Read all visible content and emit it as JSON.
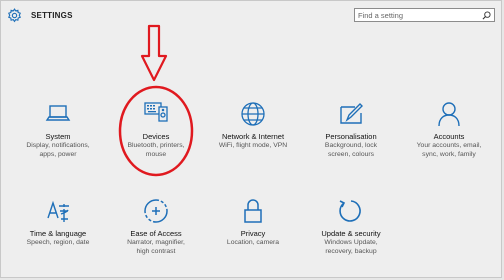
{
  "header": {
    "title": "SETTINGS",
    "search_placeholder": "Find a setting"
  },
  "tiles": [
    {
      "icon": "system-icon",
      "name": "System",
      "desc": [
        "Display, notifications,",
        "apps, power"
      ]
    },
    {
      "icon": "devices-icon",
      "name": "Devices",
      "desc": [
        "Bluetooth, printers,",
        "mouse"
      ]
    },
    {
      "icon": "network-icon",
      "name": "Network & Internet",
      "desc": [
        "WiFi, flight mode, VPN"
      ]
    },
    {
      "icon": "personalisation-icon",
      "name": "Personalisation",
      "desc": [
        "Background, lock",
        "screen, colours"
      ]
    },
    {
      "icon": "accounts-icon",
      "name": "Accounts",
      "desc": [
        "Your accounts, email,",
        "sync, work, family"
      ]
    },
    {
      "icon": "time-language-icon",
      "name": "Time & language",
      "desc": [
        "Speech, region, date"
      ]
    },
    {
      "icon": "ease-of-access-icon",
      "name": "Ease of Access",
      "desc": [
        "Narrator, magnifier,",
        "high contrast"
      ]
    },
    {
      "icon": "privacy-icon",
      "name": "Privacy",
      "desc": [
        "Location, camera"
      ]
    },
    {
      "icon": "update-security-icon",
      "name": "Update & security",
      "desc": [
        "Windows Update,",
        "recovery, backup"
      ]
    }
  ],
  "colors": {
    "accent": "#1e6fb8",
    "annotation": "#e0191f"
  }
}
